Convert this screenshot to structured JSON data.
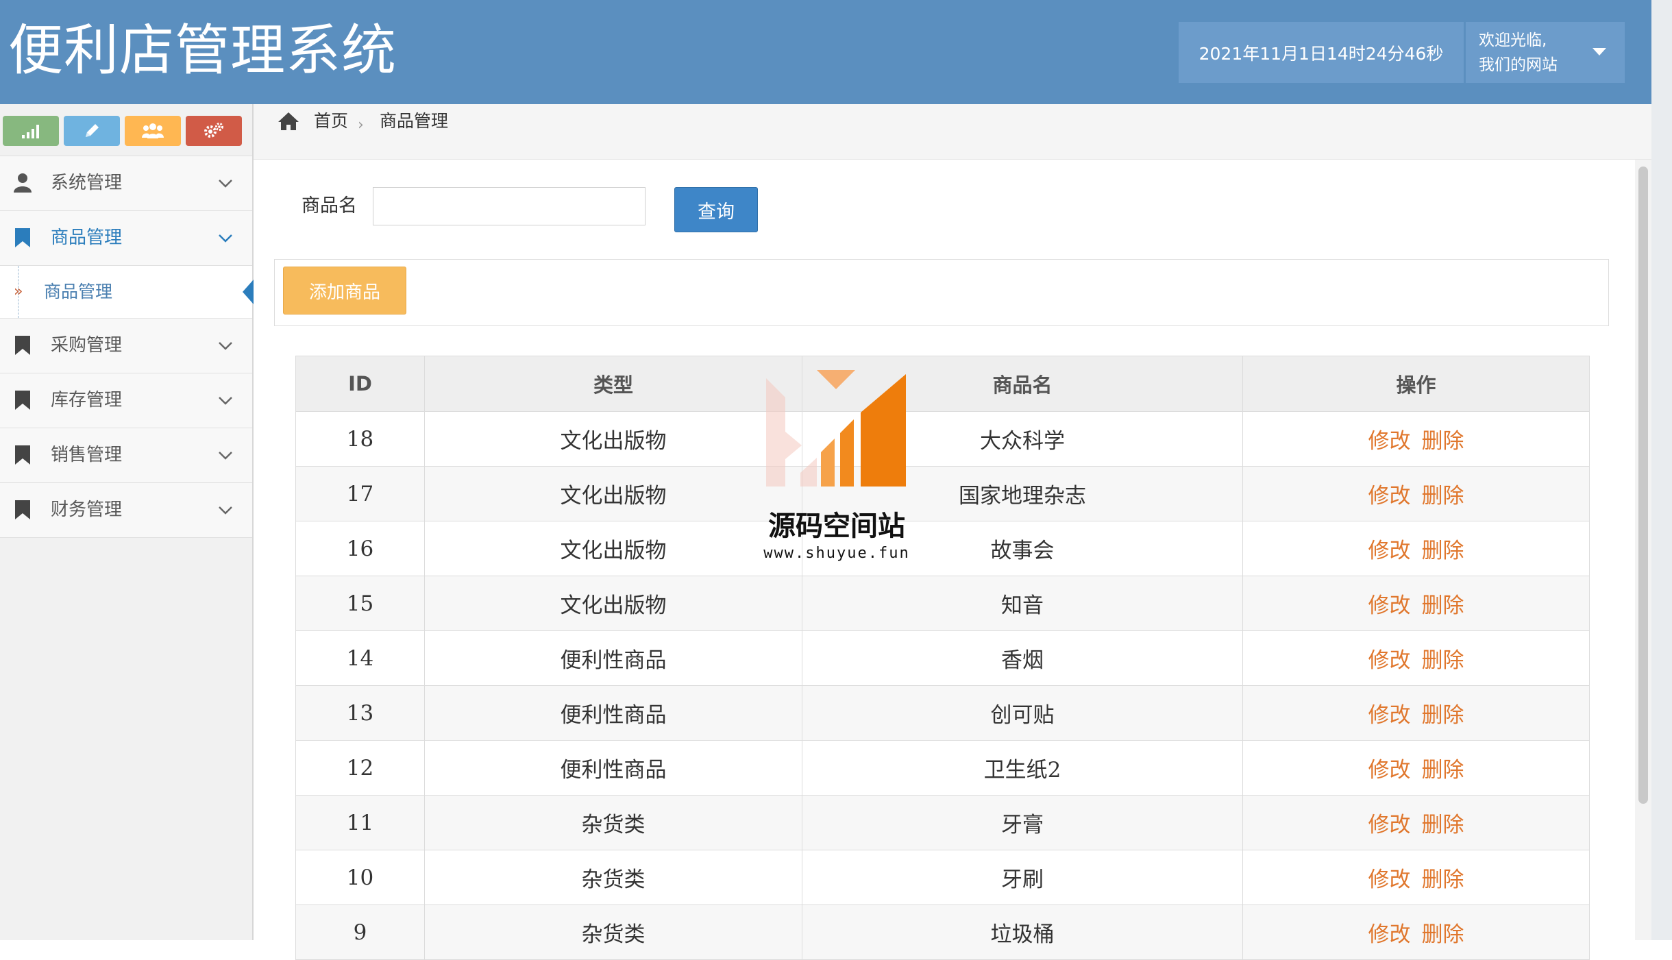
{
  "header": {
    "app_title": "便利店管理系统",
    "datetime": "2021年11月1日14时24分46秒",
    "user_line1": "欢迎光临,",
    "user_line2": "我们的网站"
  },
  "sidebar": {
    "shortcut_icons": [
      "signal-icon",
      "pencil-icon",
      "users-icon",
      "cogs-icon"
    ],
    "shortcut_colors": [
      "#87b87f",
      "#6fb3e0",
      "#ffb752",
      "#d15b47"
    ],
    "items": [
      {
        "label": "系统管理",
        "icon": "user-icon"
      },
      {
        "label": "商品管理",
        "icon": "bookmark-icon",
        "active": true
      },
      {
        "label": "采购管理",
        "icon": "bookmark-icon"
      },
      {
        "label": "库存管理",
        "icon": "bookmark-icon"
      },
      {
        "label": "销售管理",
        "icon": "bookmark-icon"
      },
      {
        "label": "财务管理",
        "icon": "bookmark-icon"
      }
    ],
    "active_sub_item": "商品管理"
  },
  "breadcrumb": {
    "home": "首页",
    "current": "商品管理"
  },
  "search": {
    "label": "商品名",
    "value": "",
    "button": "查询"
  },
  "toolbar": {
    "add_button": "添加商品"
  },
  "table": {
    "headers": [
      "ID",
      "类型",
      "商品名",
      "操作"
    ],
    "edit_label": "修改",
    "delete_label": "删除",
    "rows": [
      {
        "id": "18",
        "type": "文化出版物",
        "name": "大众科学"
      },
      {
        "id": "17",
        "type": "文化出版物",
        "name": "国家地理杂志"
      },
      {
        "id": "16",
        "type": "文化出版物",
        "name": "故事会"
      },
      {
        "id": "15",
        "type": "文化出版物",
        "name": "知音"
      },
      {
        "id": "14",
        "type": "便利性商品",
        "name": "香烟"
      },
      {
        "id": "13",
        "type": "便利性商品",
        "name": "创可贴"
      },
      {
        "id": "12",
        "type": "便利性商品",
        "name": "卫生纸2"
      },
      {
        "id": "11",
        "type": "杂货类",
        "name": "牙膏"
      },
      {
        "id": "10",
        "type": "杂货类",
        "name": "牙刷"
      },
      {
        "id": "9",
        "type": "杂货类",
        "name": "垃圾桶"
      }
    ]
  },
  "watermark": {
    "text": "源码空间站",
    "url": "www.shuyue.fun"
  },
  "colors": {
    "header_bg": "#5b8fbf",
    "accent_blue": "#2b7dbc",
    "action_orange": "#e0772d",
    "add_button": "#f7bb5c"
  }
}
